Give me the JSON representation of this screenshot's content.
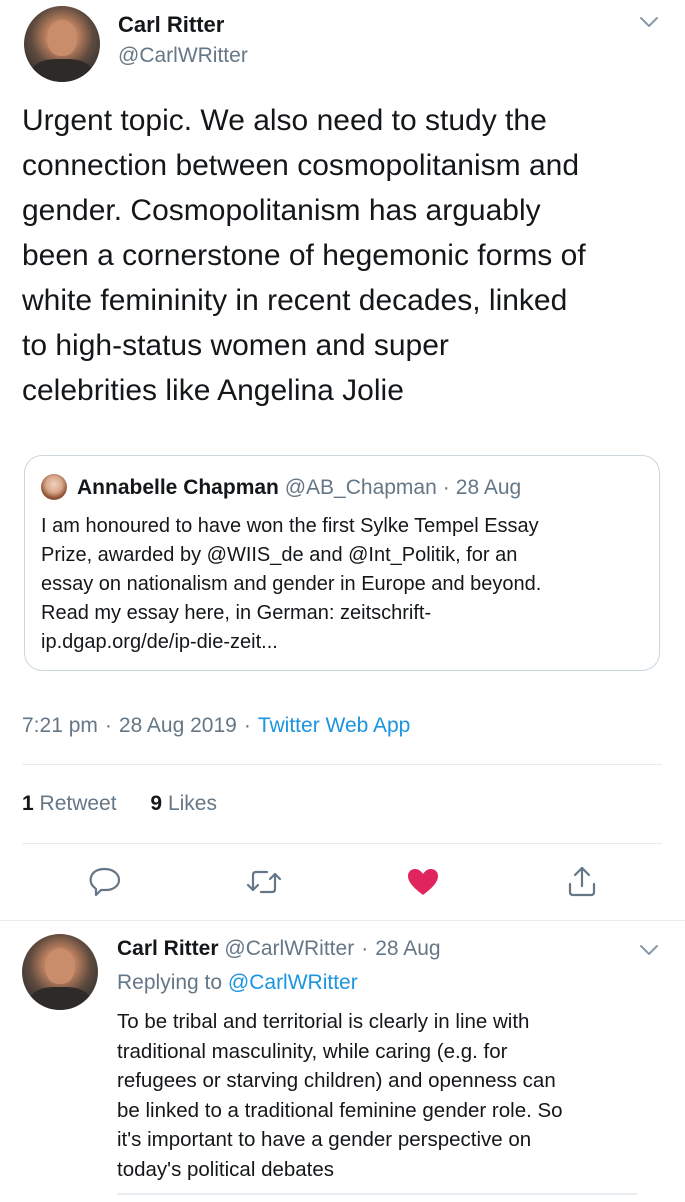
{
  "colors": {
    "link": "#1b95e0",
    "muted": "#657786",
    "like_active": "#e0245e",
    "border": "#ccd6dd"
  },
  "main_tweet": {
    "author_name": "Carl Ritter",
    "author_handle": "@CarlWRitter",
    "text_lines": [
      "Urgent topic. We also need to study the",
      "connection between cosmopolitanism and",
      "gender. Cosmopolitanism has arguably",
      "been a cornerstone of hegemonic forms of",
      "white femininity in recent decades, linked",
      "to high-status women and super",
      "celebrities like Angelina Jolie"
    ],
    "quoted_tweet": {
      "author_name": "Annabelle Chapman",
      "author_handle": "@AB_Chapman",
      "separator": "·",
      "date": "28 Aug",
      "text_lines": [
        "I am honoured to have won the first Sylke Tempel Essay",
        "Prize, awarded by @WIIS_de and @Int_Politik, for an",
        "essay on nationalism and gender in Europe and beyond.",
        "Read my essay here, in German: zeitschrift-",
        "ip.dgap.org/de/ip-die-zeit..."
      ]
    },
    "time": "7:21 pm",
    "separator": "·",
    "date": "28 Aug 2019",
    "source": "Twitter Web App",
    "retweet_count": "1",
    "retweet_label": "Retweet",
    "like_count": "9",
    "like_label": "Likes",
    "actions": [
      "reply-icon",
      "retweet-icon",
      "like-icon",
      "share-icon"
    ]
  },
  "reply_tweet": {
    "author_name": "Carl Ritter",
    "author_handle": "@CarlWRitter",
    "separator": "·",
    "date": "28 Aug",
    "replying_prefix": "Replying to",
    "replying_to": "@CarlWRitter",
    "text_lines": [
      "To be tribal and territorial is clearly in line with",
      "traditional masculinity, while caring (e.g. for",
      "refugees or starving children) and openness can",
      "be linked to a traditional feminine gender role. So",
      "it's important to have a gender perspective on",
      "today's political debates"
    ]
  }
}
